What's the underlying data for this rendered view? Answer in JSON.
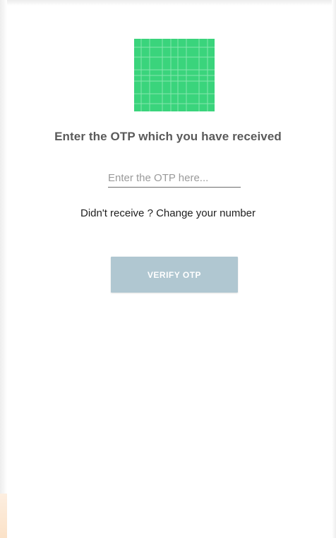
{
  "logo": {
    "icon": "grid-logo-icon",
    "color": "#3ad47c"
  },
  "heading": "Enter the OTP which you have received",
  "otp_input": {
    "value": "",
    "placeholder": "Enter the OTP here..."
  },
  "change_number_text": "Didn't receive ? Change your number",
  "verify_button": {
    "label": "VERIFY OTP",
    "color": "#b0c7d1"
  }
}
